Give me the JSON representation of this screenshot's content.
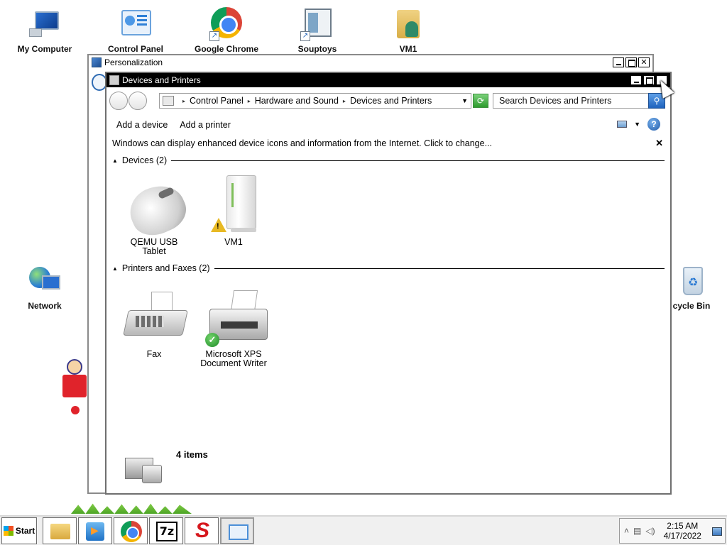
{
  "desktop": {
    "icons": [
      {
        "label": "My Computer",
        "icon": "computer-icon"
      },
      {
        "label": "Control Panel",
        "icon": "control-panel-icon"
      },
      {
        "label": "Google Chrome",
        "icon": "chrome-icon"
      },
      {
        "label": "Souptoys Playsets",
        "icon": "souptoys-icon"
      },
      {
        "label": "VM1",
        "icon": "user-folder-icon"
      },
      {
        "label": "Network",
        "icon": "network-icon"
      },
      {
        "label": "cycle Bin",
        "icon": "recycle-bin-icon"
      }
    ]
  },
  "personalization_window": {
    "title": "Personalization"
  },
  "devices_window": {
    "title": "Devices and Printers",
    "address": {
      "crumbs": [
        "Control Panel",
        "Hardware and Sound",
        "Devices and Printers"
      ]
    },
    "search": {
      "placeholder": "Search Devices and Printers"
    },
    "commands": {
      "add_device": "Add a device",
      "add_printer": "Add a printer"
    },
    "infobar": {
      "text": "Windows can display enhanced device icons and information from the Internet. Click to change..."
    },
    "groups": {
      "devices": {
        "header": "Devices (2)",
        "items": [
          {
            "line1": "QEMU USB",
            "line2": "Tablet",
            "icon": "mouse-icon"
          },
          {
            "line1": "VM1",
            "line2": "",
            "icon": "computer-tower-icon",
            "status": "warning"
          }
        ]
      },
      "printers": {
        "header": "Printers and Faxes (2)",
        "items": [
          {
            "line1": "Fax",
            "line2": "",
            "icon": "fax-icon"
          },
          {
            "line1": "Microsoft XPS",
            "line2": "Document Writer",
            "icon": "printer-icon",
            "status": "default"
          }
        ]
      }
    },
    "footer": {
      "count": "4 items"
    }
  },
  "taskbar": {
    "start_label": "Start",
    "apps": [
      "file-explorer-icon",
      "media-player-icon",
      "chrome-icon",
      "7zip-icon",
      "souptoys-icon",
      "control-panel-icon"
    ],
    "clock": {
      "time": "2:15 AM",
      "date": "4/17/2022"
    }
  },
  "colors": {
    "active_titlebar": "#000000",
    "inactive_titlebar": "#ffffff",
    "taskbar": "#f0f0f0"
  }
}
